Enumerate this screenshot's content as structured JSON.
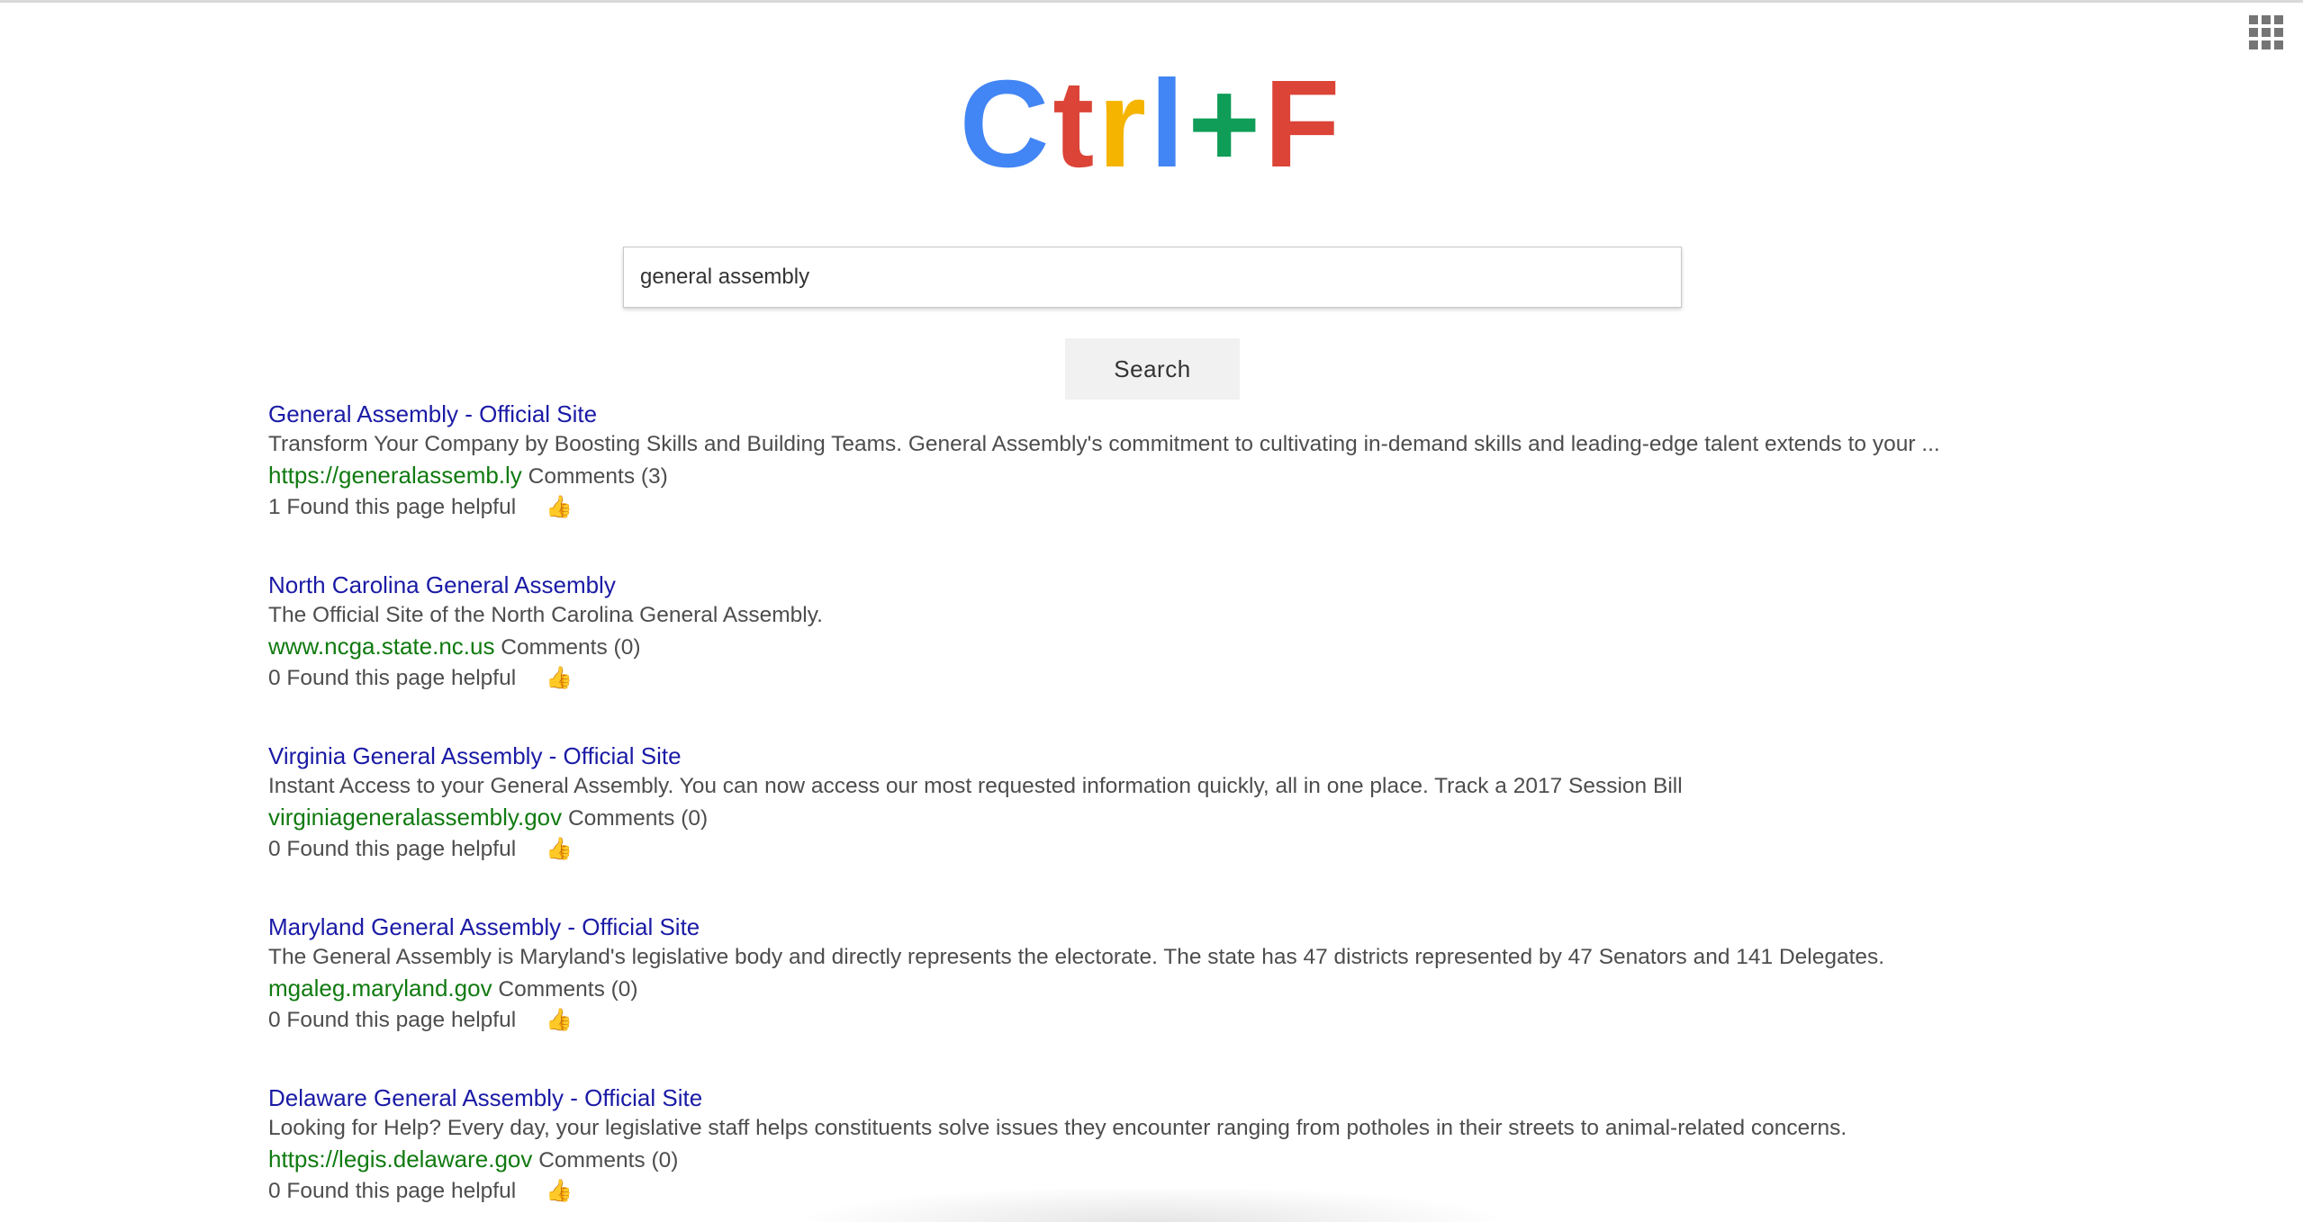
{
  "logo": {
    "letters": [
      {
        "char": "C",
        "color": "#4285f4"
      },
      {
        "char": "t",
        "color": "#db4437"
      },
      {
        "char": "r",
        "color": "#f4b400"
      },
      {
        "char": "l",
        "color": "#4285f4"
      },
      {
        "char": "+",
        "color": "#0f9d58"
      },
      {
        "char": "F",
        "color": "#db4437"
      }
    ]
  },
  "apps_icon": "apps-grid-icon",
  "search": {
    "value": "general assembly",
    "button_label": "Search"
  },
  "results": [
    {
      "title": "General Assembly - Official Site",
      "snippet": "Transform Your Company by Boosting Skills and Building Teams. General Assembly's commitment to cultivating in-demand skills and leading-edge talent extends to your ...",
      "url": "https://generalassemb.ly",
      "comments": "Comments (3)",
      "helpful": "1 Found this page helpful"
    },
    {
      "title": "North Carolina General Assembly",
      "snippet": "The Official Site of the North Carolina General Assembly.",
      "url": "www.ncga.state.nc.us",
      "comments": "Comments (0)",
      "helpful": "0 Found this page helpful"
    },
    {
      "title": "Virginia General Assembly - Official Site",
      "snippet": "Instant Access to your General Assembly. You can now access our most requested information quickly, all in one place. Track a 2017 Session Bill",
      "url": "virginiageneralassembly.gov",
      "comments": "Comments (0)",
      "helpful": "0 Found this page helpful"
    },
    {
      "title": "Maryland General Assembly - Official Site",
      "snippet": "The General Assembly is Maryland's legislative body and directly represents the electorate. The state has 47 districts represented by 47 Senators and 141 Delegates.",
      "url": "mgaleg.maryland.gov",
      "comments": "Comments (0)",
      "helpful": "0 Found this page helpful"
    },
    {
      "title": "Delaware General Assembly - Official Site",
      "snippet": "Looking for Help? Every day, your legislative staff helps constituents solve issues they encounter ranging from potholes in their streets to animal-related concerns.",
      "url": "https://legis.delaware.gov",
      "comments": "Comments (0)",
      "helpful": "0 Found this page helpful"
    }
  ],
  "thumb_icon": "thumbs-up-icon",
  "colors": {
    "title_link": "#1a1aa6",
    "url_green": "#107a10",
    "thumb": "#e6a823"
  }
}
